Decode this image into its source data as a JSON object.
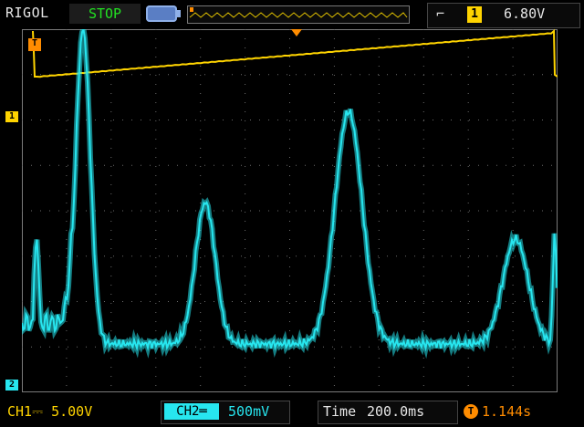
{
  "header": {
    "brand": "RIGOL",
    "run_state": "STOP",
    "trigger_channel": "1",
    "trigger_level": "6.80V"
  },
  "markers": {
    "ch1": "1",
    "ch2": "2",
    "trigger": "T"
  },
  "footer": {
    "ch1": "CH1⎓  5.00V",
    "ch2_tag": "CH2═",
    "ch2_scale": "500mV",
    "time_label": "Time",
    "time_scale": "200.0ms",
    "trigger_offset": "1.144s"
  },
  "colors": {
    "ch1": "#ffd400",
    "ch2": "#27e6ef",
    "trigger": "#ff8c00",
    "grid": "#6a6a6a"
  }
}
